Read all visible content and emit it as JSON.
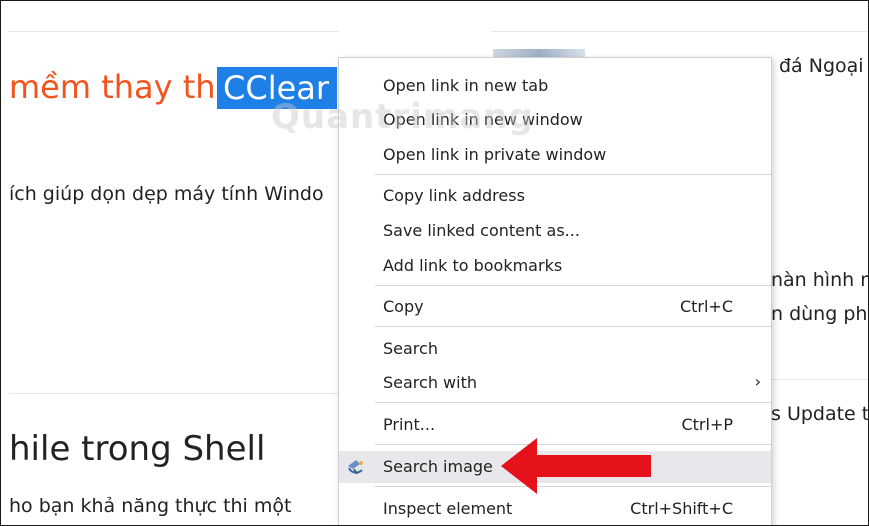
{
  "background": {
    "title_prefix": "mềm thay thế ",
    "title_highlight": "CClear",
    "intro_text": "ích giúp dọn dẹp máy tính Windo",
    "heading": "hile trong Shell",
    "body_text": "ho bạn khả năng thực thi một",
    "right_texts": [
      "đá Ngoại",
      "nàn hình m",
      "n dùng pha",
      "s Update t"
    ],
    "watermark": "Quantrimang"
  },
  "context_menu": {
    "items": [
      {
        "label": "Open link in new tab",
        "shortcut": ""
      },
      {
        "label": "Open link in new window",
        "shortcut": ""
      },
      {
        "label": "Open link in private window",
        "shortcut": ""
      },
      {
        "label": "Copy link address",
        "shortcut": ""
      },
      {
        "label": "Save linked content as...",
        "shortcut": ""
      },
      {
        "label": "Add link to bookmarks",
        "shortcut": ""
      },
      {
        "label": "Copy",
        "shortcut": "Ctrl+C"
      },
      {
        "label": "Search",
        "shortcut": ""
      },
      {
        "label": "Search with",
        "shortcut": "",
        "submenu": "›"
      },
      {
        "label": "Print...",
        "shortcut": "Ctrl+P"
      },
      {
        "label": "Search image",
        "shortcut": ""
      },
      {
        "label": "Inspect element",
        "shortcut": "Ctrl+Shift+C"
      }
    ]
  },
  "colors": {
    "title_orange": "#f1541d",
    "highlight_blue": "#1e80e6",
    "arrow_red": "#e5111b",
    "hover_bg": "#e8e8ec"
  },
  "icons": {
    "search_image": "search-image-icon",
    "pointer_arrow": "red-arrow-icon"
  }
}
